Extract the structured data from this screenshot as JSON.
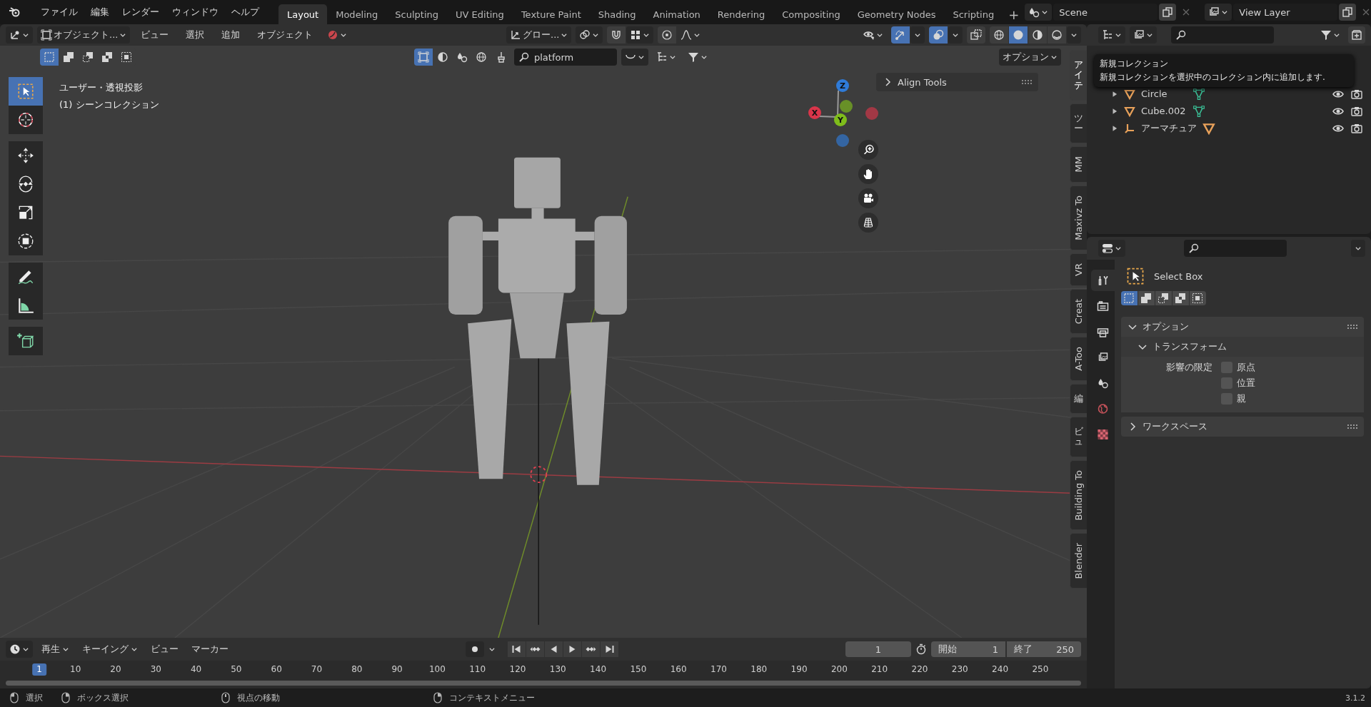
{
  "topbar": {
    "menus": [
      "ファイル",
      "編集",
      "レンダー",
      "ウィンドウ",
      "ヘルプ"
    ],
    "workspaces": [
      {
        "label": "Layout",
        "selected": true
      },
      {
        "label": "Modeling",
        "selected": false
      },
      {
        "label": "Sculpting",
        "selected": false
      },
      {
        "label": "UV Editing",
        "selected": false
      },
      {
        "label": "Texture Paint",
        "selected": false
      },
      {
        "label": "Shading",
        "selected": false
      },
      {
        "label": "Animation",
        "selected": false
      },
      {
        "label": "Rendering",
        "selected": false
      },
      {
        "label": "Compositing",
        "selected": false
      },
      {
        "label": "Geometry Nodes",
        "selected": false
      },
      {
        "label": "Scripting",
        "selected": false
      }
    ],
    "add_workspace": "+",
    "scene": "Scene",
    "view_layer": "View Layer"
  },
  "viewport": {
    "header": {
      "mode": "オブジェクト...",
      "menus": [
        "ビュー",
        "選択",
        "追加",
        "オブジェクト"
      ],
      "orientation": "グロー...",
      "snap_on": false,
      "proportional_on": false,
      "gizmos_on": true,
      "overlays_on": true,
      "xray_on": false,
      "shading": [
        {
          "selected": false
        },
        {
          "selected": true
        },
        {
          "selected": false
        },
        {
          "selected": false
        }
      ]
    },
    "header2": {
      "select_modes": [
        {
          "selected": true
        },
        {
          "selected": false
        },
        {
          "selected": false
        },
        {
          "selected": false
        },
        {
          "selected": false
        }
      ],
      "object_types": [
        {
          "on": true
        },
        {
          "on": false
        },
        {
          "on": false
        },
        {
          "on": false
        },
        {
          "on": false
        }
      ],
      "search": "platform",
      "options": "オプション"
    },
    "tools": [
      {
        "selected": true
      },
      {
        "selected": false
      },
      {
        "selected": false
      },
      {
        "selected": false
      },
      {
        "selected": false
      },
      {
        "selected": false
      },
      {
        "selected": false
      },
      {
        "selected": false
      },
      {
        "selected": false
      }
    ],
    "overlay_text": [
      "ユーザー・透視投影",
      "(1) シーンコレクション"
    ],
    "gizmo_axes": [
      {
        "label": "Z",
        "color": "#2f7bd8"
      },
      {
        "label": "X",
        "color": "#d9354a"
      },
      {
        "label": "Y",
        "color": "#7fbd1b"
      }
    ],
    "panels": [
      {
        "label": "Align Tools",
        "expanded": false
      }
    ],
    "sidebar_tabs": [
      {
        "label": "アイテ",
        "kind": "stacked",
        "selected": true
      },
      {
        "label": "ツー",
        "kind": "stacked",
        "selected": false
      },
      {
        "label": "MM",
        "kind": "rotated",
        "selected": false
      },
      {
        "label": "Maxivz To",
        "kind": "rotated",
        "selected": false
      },
      {
        "label": "VR",
        "kind": "rotated",
        "selected": false
      },
      {
        "label": "Creat",
        "kind": "rotated",
        "selected": false
      },
      {
        "label": "A-Too",
        "kind": "rotated",
        "selected": false
      },
      {
        "label": "編",
        "kind": "stacked",
        "selected": false
      },
      {
        "label": "ビュ",
        "kind": "stacked",
        "selected": false
      },
      {
        "label": "Building To",
        "kind": "rotated",
        "selected": false
      },
      {
        "label": "Blender",
        "kind": "rotated",
        "selected": false
      }
    ]
  },
  "outliner": {
    "tooltip": {
      "title": "新規コレクション",
      "text": "新規コレクションを選択中のコレクション内に追加します."
    },
    "rows": [
      {
        "name": "Circle",
        "kind": "mesh",
        "expanded": false
      },
      {
        "name": "Cube.002",
        "kind": "mesh",
        "expanded": false
      },
      {
        "name": "アーマチュア",
        "kind": "armature",
        "expanded": false
      }
    ]
  },
  "properties": {
    "tabs": [
      {
        "selected": true
      },
      {
        "selected": false
      },
      {
        "selected": false
      },
      {
        "selected": false
      },
      {
        "selected": false
      },
      {
        "selected": false
      },
      {
        "selected": false
      }
    ],
    "tool": "Select Box",
    "select_modes": [
      {
        "selected": true
      },
      {
        "selected": false
      },
      {
        "selected": false
      },
      {
        "selected": false
      },
      {
        "selected": false
      }
    ],
    "panels": [
      {
        "label": "オプション",
        "expanded": true,
        "subpanel": {
          "label": "トランスフォーム",
          "expanded": true,
          "field_label": "影響の限定",
          "options": [
            {
              "label": "原点",
              "checked": false
            },
            {
              "label": "位置",
              "checked": false
            },
            {
              "label": "親",
              "checked": false
            }
          ]
        }
      },
      {
        "label": "ワークスペース",
        "expanded": false
      }
    ]
  },
  "timeline": {
    "menus": [
      {
        "label": "再生",
        "dropdown": true
      },
      {
        "label": "キーイング",
        "dropdown": true
      },
      {
        "label": "ビュー",
        "dropdown": false
      },
      {
        "label": "マーカー",
        "dropdown": false
      }
    ],
    "auto_keying": false,
    "current_frame": "1",
    "start_label": "開始",
    "start": "1",
    "end_label": "終了",
    "end": "250",
    "ruler": [
      {
        "label": "1",
        "selected": true
      },
      {
        "label": "10",
        "selected": false
      },
      {
        "label": "20",
        "selected": false
      },
      {
        "label": "30",
        "selected": false
      },
      {
        "label": "40",
        "selected": false
      },
      {
        "label": "50",
        "selected": false
      },
      {
        "label": "60",
        "selected": false
      },
      {
        "label": "70",
        "selected": false
      },
      {
        "label": "80",
        "selected": false
      },
      {
        "label": "90",
        "selected": false
      },
      {
        "label": "100",
        "selected": false
      },
      {
        "label": "110",
        "selected": false
      },
      {
        "label": "120",
        "selected": false
      },
      {
        "label": "130",
        "selected": false
      },
      {
        "label": "140",
        "selected": false
      },
      {
        "label": "150",
        "selected": false
      },
      {
        "label": "160",
        "selected": false
      },
      {
        "label": "170",
        "selected": false
      },
      {
        "label": "180",
        "selected": false
      },
      {
        "label": "190",
        "selected": false
      },
      {
        "label": "200",
        "selected": false
      },
      {
        "label": "210",
        "selected": false
      },
      {
        "label": "220",
        "selected": false
      },
      {
        "label": "230",
        "selected": false
      },
      {
        "label": "240",
        "selected": false
      },
      {
        "label": "250",
        "selected": false
      }
    ]
  },
  "status_bar": {
    "hints": [
      "選択",
      "ボックス選択",
      "視点の移動",
      "コンテキストメニュー"
    ],
    "version": "3.1.2"
  }
}
